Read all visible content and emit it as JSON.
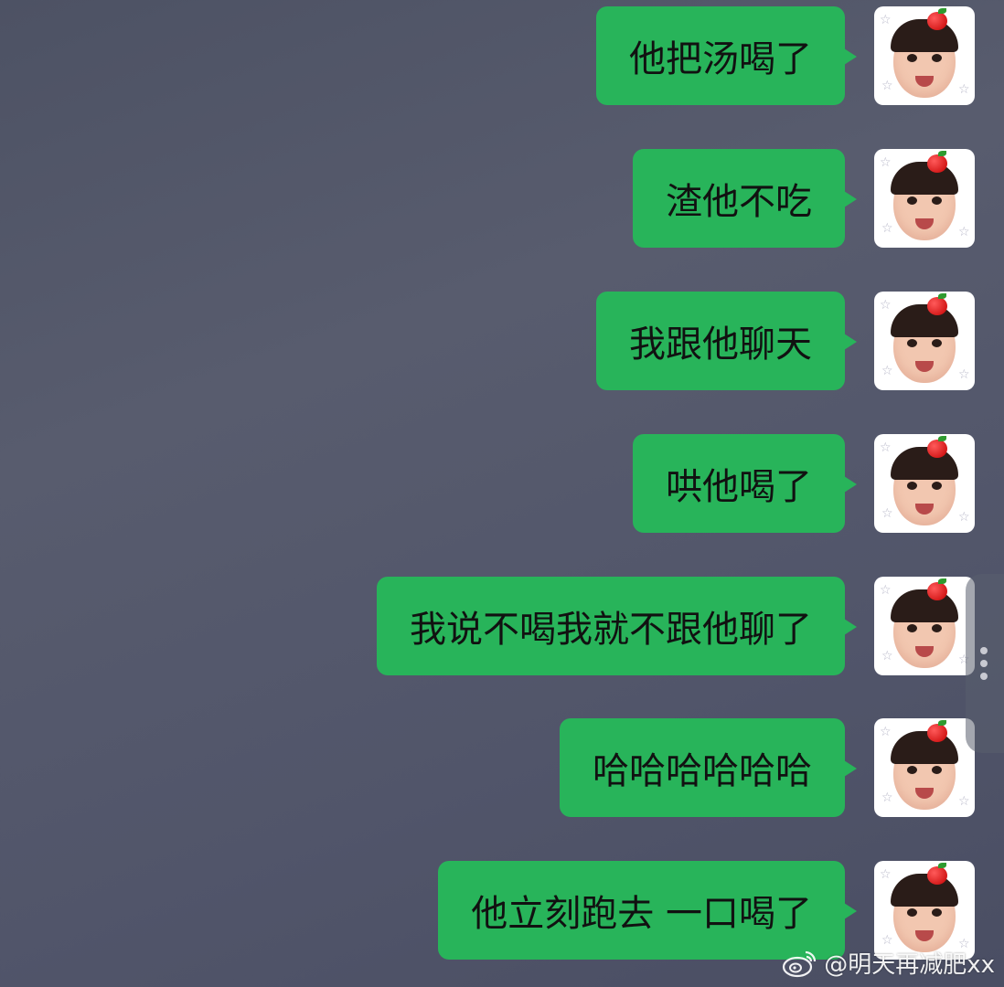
{
  "messages": [
    {
      "text": "他把汤喝了"
    },
    {
      "text": "渣他不吃"
    },
    {
      "text": "我跟他聊天"
    },
    {
      "text": "哄他喝了"
    },
    {
      "text": "我说不喝我就不跟他聊了"
    },
    {
      "text": "哈哈哈哈哈哈"
    },
    {
      "text": "他立刻跑去 一口喝了"
    }
  ],
  "watermark": {
    "text": "@明天再减肥xx",
    "icon": "weibo-logo-icon"
  },
  "colors": {
    "bubble": "#28b45a",
    "background": "#545869"
  }
}
